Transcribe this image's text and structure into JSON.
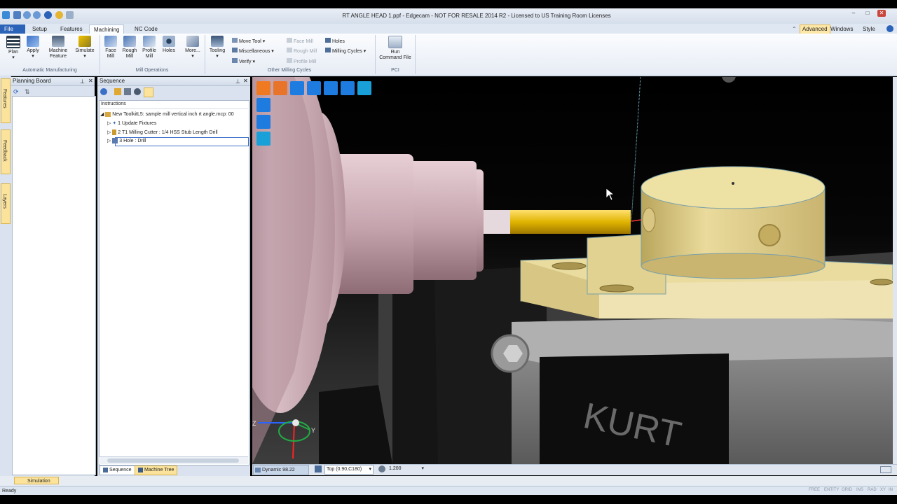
{
  "window": {
    "title": "RT ANGLE HEAD 1.ppf - Edgecam - NOT FOR RESALE 2014 R2 - Licensed to US Training Room Licenses"
  },
  "tabs": [
    "File",
    "Setup",
    "Features",
    "Machining",
    "NC Code"
  ],
  "active_tab": "Machining",
  "right_menu": {
    "advanced": "Advanced",
    "windows": "Windows",
    "style": "Style"
  },
  "ribbon": {
    "automatic": {
      "plan": "Plan",
      "apply": "Apply",
      "machine_feature_1": "Machine",
      "machine_feature_2": "Feature",
      "simulate": "Simulate",
      "group": "Automatic Manufacturing"
    },
    "mill_ops": {
      "face_1": "Face",
      "face_2": "Mill",
      "rough_1": "Rough",
      "rough_2": "Mill",
      "profile_1": "Profile",
      "profile_2": "Mill",
      "holes": "Holes",
      "more": "More...",
      "group": "Mill Operations"
    },
    "other": {
      "tooling": "Tooling",
      "move_tool": "Move Tool",
      "miscellaneous": "Miscellaneous",
      "verify": "Verify",
      "face_mill": "Face Mill",
      "rough_mill": "Rough Mill",
      "profile_mill": "Profile Mill",
      "holes": "Holes",
      "milling_cycles": "Milling Cycles",
      "group": "Other Milling Cycles"
    },
    "pci": {
      "run_1": "Run",
      "run_2": "Command File",
      "group": "PCI"
    }
  },
  "side_tabs": [
    "Features",
    "Feedback",
    "Layers"
  ],
  "planning_board": {
    "title": "Planning Board"
  },
  "sequence": {
    "title": "Sequence",
    "header": "Instructions",
    "root": "New ToolkitL5: sample mill vertical inch rt angle.mcp: 00",
    "items": [
      "1 Update Fixtures",
      "2 T1 Milling Cutter : 1/4 HSS Stub Length Drill",
      "3 Hole : Drill"
    ],
    "bottom_tabs": [
      "Sequence",
      "Machine Tree"
    ]
  },
  "viewport": {
    "axes": [
      "Z",
      "Y"
    ],
    "vise_text": "KURT"
  },
  "view_status": {
    "mode": "Dynamic 98.22",
    "view": "Top (0.90,C180)",
    "zoom": "1.200"
  },
  "simulation_tab": "Simulation",
  "status": {
    "left": "Ready",
    "indicators": [
      "FREE",
      "ENTITY",
      "GRID",
      "INS",
      "RAD",
      "XY",
      "IN"
    ]
  },
  "colors": {
    "accent": "#2b63b8",
    "part": "#e6d592",
    "tool": "#e0b400",
    "spindle": "#c9a3ae",
    "highlight": "#fbe39c"
  }
}
